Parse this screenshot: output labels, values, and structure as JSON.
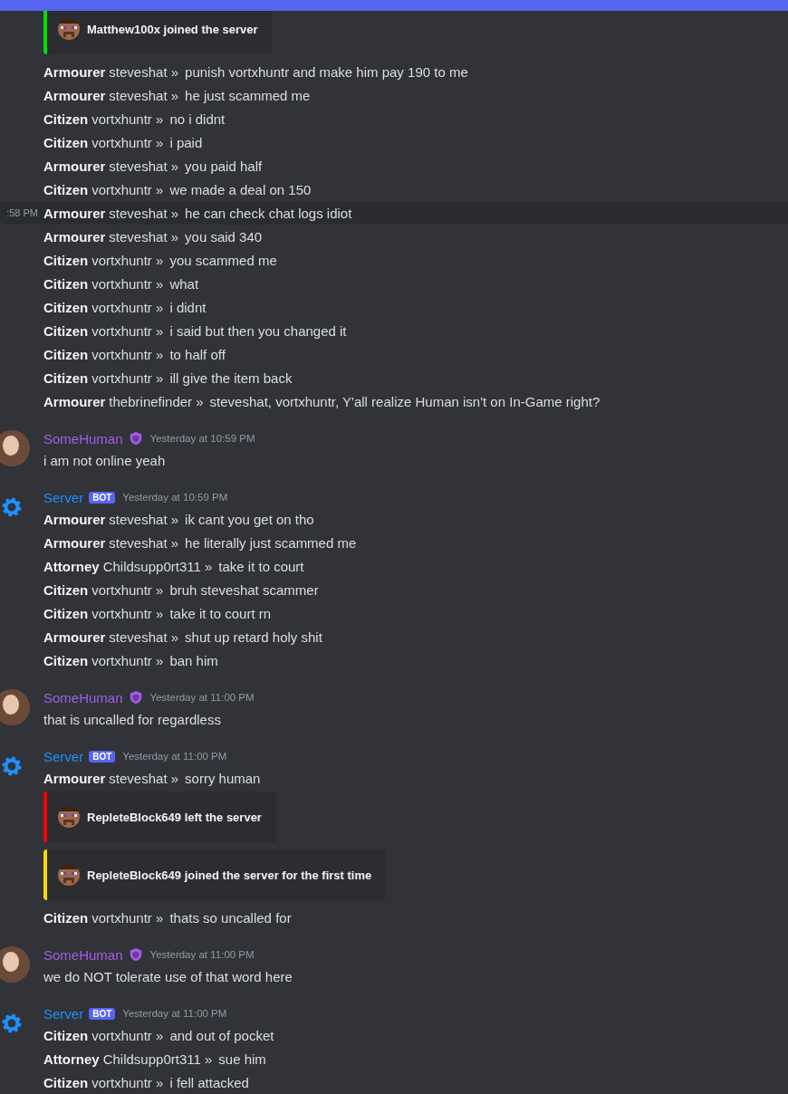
{
  "groups": [
    {
      "items": [
        {
          "kind": "embed",
          "color": "#00e000",
          "text": "Matthew100x joined the server"
        },
        {
          "kind": "chat",
          "rank": "Armourer",
          "player": "steveshat »",
          "text": "punish vortxhuntr and make him pay 190 to me"
        },
        {
          "kind": "chat",
          "rank": "Armourer",
          "player": "steveshat »",
          "text": "he just scammed me"
        },
        {
          "kind": "chat",
          "rank": "Citizen",
          "player": "vortxhuntr »",
          "text": "no i didnt"
        },
        {
          "kind": "chat",
          "rank": "Citizen",
          "player": "vortxhuntr »",
          "text": "i paid"
        },
        {
          "kind": "chat",
          "rank": "Armourer",
          "player": "steveshat »",
          "text": "you paid half"
        },
        {
          "kind": "chat",
          "rank": "Citizen",
          "player": "vortxhuntr »",
          "text": "we made a deal on 150"
        },
        {
          "kind": "chat",
          "rank": "Armourer",
          "player": "steveshat »",
          "text": "he can check chat logs idiot",
          "time": ":58 PM"
        },
        {
          "kind": "chat",
          "rank": "Armourer",
          "player": "steveshat »",
          "text": "you said 340"
        },
        {
          "kind": "chat",
          "rank": "Citizen",
          "player": "vortxhuntr »",
          "text": "you scammed me"
        },
        {
          "kind": "chat",
          "rank": "Citizen",
          "player": "vortxhuntr »",
          "text": "what"
        },
        {
          "kind": "chat",
          "rank": "Citizen",
          "player": "vortxhuntr »",
          "text": "i didnt"
        },
        {
          "kind": "chat",
          "rank": "Citizen",
          "player": "vortxhuntr »",
          "text": "i said but then you changed it"
        },
        {
          "kind": "chat",
          "rank": "Citizen",
          "player": "vortxhuntr »",
          "text": "to half off"
        },
        {
          "kind": "chat",
          "rank": "Citizen",
          "player": "vortxhuntr »",
          "text": "ill give the item back"
        },
        {
          "kind": "chat",
          "rank": "Armourer",
          "player": "thebrinefinder »",
          "text": "steveshat, vortxhuntr, Y'all realize Human isn't on In-Game right?"
        }
      ]
    },
    {
      "author": {
        "kind": "user",
        "name": "SomeHuman",
        "color": "#a35ee6",
        "badge": {
          "kind": "role"
        },
        "time": "Yesterday at 10:59 PM"
      },
      "items": [
        {
          "kind": "text",
          "text": "i am not online yeah"
        }
      ]
    },
    {
      "author": {
        "kind": "bot",
        "name": "Server",
        "color": "#1e90ff",
        "badge": {
          "kind": "bot",
          "label": "BOT"
        },
        "time": "Yesterday at 10:59 PM"
      },
      "items": [
        {
          "kind": "chat",
          "rank": "Armourer",
          "player": "steveshat »",
          "text": "ik cant you get on tho"
        },
        {
          "kind": "chat",
          "rank": "Armourer",
          "player": "steveshat »",
          "text": "he literally just scammed me"
        },
        {
          "kind": "chat",
          "rank": "Attorney",
          "player": "Childsupp0rt311 »",
          "text": "take it to court"
        },
        {
          "kind": "chat",
          "rank": "Citizen",
          "player": "vortxhuntr »",
          "text": "bruh steveshat scammer"
        },
        {
          "kind": "chat",
          "rank": "Citizen",
          "player": "vortxhuntr »",
          "text": "take it to court rn"
        },
        {
          "kind": "chat",
          "rank": "Armourer",
          "player": "steveshat »",
          "text": "shut up retard holy shit"
        },
        {
          "kind": "chat",
          "rank": "Citizen",
          "player": "vortxhuntr »",
          "text": "ban him"
        }
      ]
    },
    {
      "author": {
        "kind": "user",
        "name": "SomeHuman",
        "color": "#a35ee6",
        "badge": {
          "kind": "role"
        },
        "time": "Yesterday at 11:00 PM"
      },
      "items": [
        {
          "kind": "text",
          "text": "that is uncalled for regardless"
        }
      ]
    },
    {
      "author": {
        "kind": "bot",
        "name": "Server",
        "color": "#1e90ff",
        "badge": {
          "kind": "bot",
          "label": "BOT"
        },
        "time": "Yesterday at 11:00 PM"
      },
      "items": [
        {
          "kind": "chat",
          "rank": "Armourer",
          "player": "steveshat »",
          "text": "sorry human"
        },
        {
          "kind": "embed",
          "color": "#ff0000",
          "text": "RepleteBlock649 left the server"
        },
        {
          "kind": "embed",
          "color": "#ffd700",
          "text": "RepleteBlock649 joined the server for the first time"
        },
        {
          "kind": "chat",
          "rank": "Citizen",
          "player": "vortxhuntr »",
          "text": "thats so uncalled for"
        }
      ]
    },
    {
      "author": {
        "kind": "user",
        "name": "SomeHuman",
        "color": "#a35ee6",
        "badge": {
          "kind": "role"
        },
        "time": "Yesterday at 11:00 PM"
      },
      "items": [
        {
          "kind": "text",
          "text": "we do NOT tolerate use of that word here"
        }
      ]
    },
    {
      "author": {
        "kind": "bot",
        "name": "Server",
        "color": "#1e90ff",
        "badge": {
          "kind": "bot",
          "label": "BOT"
        },
        "time": "Yesterday at 11:00 PM"
      },
      "items": [
        {
          "kind": "chat",
          "rank": "Citizen",
          "player": "vortxhuntr »",
          "text": "and out of pocket"
        },
        {
          "kind": "chat",
          "rank": "Attorney",
          "player": "Childsupp0rt311 »",
          "text": "sue him"
        },
        {
          "kind": "chat",
          "rank": "Citizen",
          "player": "vortxhuntr »",
          "text": "i fell attacked"
        }
      ]
    }
  ]
}
